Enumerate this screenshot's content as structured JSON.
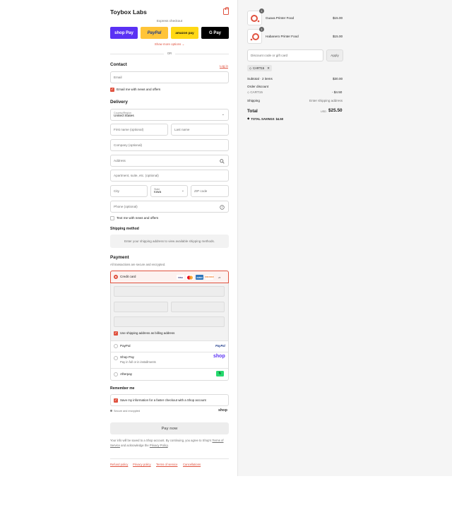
{
  "store": {
    "name": "Toybox Labs",
    "bag_icon": "shopping-bag-icon"
  },
  "express": {
    "label": "Express checkout",
    "shop_pay": "shop Pay",
    "paypal": "PayPal",
    "amazon_pay": "amazon pay",
    "google_pay": "G Pay",
    "show_more": "Show more options",
    "or": "OR"
  },
  "contact": {
    "title": "Contact",
    "login": "Log in",
    "email_placeholder": "Email",
    "email_news": "Email me with news and offers"
  },
  "delivery": {
    "title": "Delivery",
    "country_label": "Country/Region",
    "country_value": "United States",
    "first_name": "First name (optional)",
    "last_name": "Last name",
    "company": "Company (optional)",
    "address": "Address",
    "apartment": "Apartment, suite, etc. (optional)",
    "city": "City",
    "state_label": "State",
    "state_value": "Iowa",
    "zip": "ZIP code",
    "phone": "Phone (optional)",
    "text_news": "Text me with news and offers"
  },
  "shipping_method": {
    "title": "Shipping method",
    "note": "Enter your shipping address to view available shipping methods."
  },
  "payment": {
    "title": "Payment",
    "subtitle": "All transactions are secure and encrypted.",
    "credit_card": "Credit card",
    "card_brands": [
      "VISA",
      "MC",
      "AMEX",
      "DISCOVER",
      "+5"
    ],
    "billing_same": "Use shipping address as billing address",
    "paypal": "PayPal",
    "paypal_logo": "PayPal",
    "shop_pay": "Shop Pay",
    "shop_pay_sub": "Pay in full or in installments",
    "shop_logo": "shop",
    "afterpay": "Afterpay"
  },
  "remember": {
    "title": "Remember me",
    "save_info": "Save my information for a faster checkout with a Shop account",
    "secure": "Secure and encrypted",
    "shop_logo": "shop"
  },
  "pay_now": "Pay now",
  "legal": {
    "prefix": "Your info will be saved to a Shop account. By continuing, you agree to Shop's",
    "terms": "Terms of Service",
    "middle": "and acknowledge the",
    "privacy": "Privacy Policy",
    "suffix": "."
  },
  "footer_links": [
    "Refund policy",
    "Privacy policy",
    "Terms of service",
    "Cancellations"
  ],
  "order": {
    "items": [
      {
        "name": "Guava Printer Food",
        "price": "$15.00",
        "qty": "1"
      },
      {
        "name": "Habanero Printer Food",
        "price": "$15.00",
        "qty": "1"
      }
    ],
    "discount_placeholder": "Discount code or gift card",
    "apply": "Apply",
    "code_tag": "CART15",
    "subtotal_label": "Subtotal · 2 items",
    "subtotal_value": "$30.00",
    "order_discount_label": "Order discount",
    "discount_code": "CART15",
    "discount_value": "- $4.50",
    "shipping_label": "Shipping",
    "shipping_value": "Enter shipping address",
    "total_label": "Total",
    "currency": "USD",
    "total_value": "$25.50",
    "savings_label": "TOTAL SAVINGS",
    "savings_value": "$4.50"
  },
  "colors": {
    "accent": "#e0523f",
    "shop_pay": "#5a31f4",
    "paypal": "#ffc439",
    "gpay": "#000000",
    "afterpay": "#26d96e"
  }
}
